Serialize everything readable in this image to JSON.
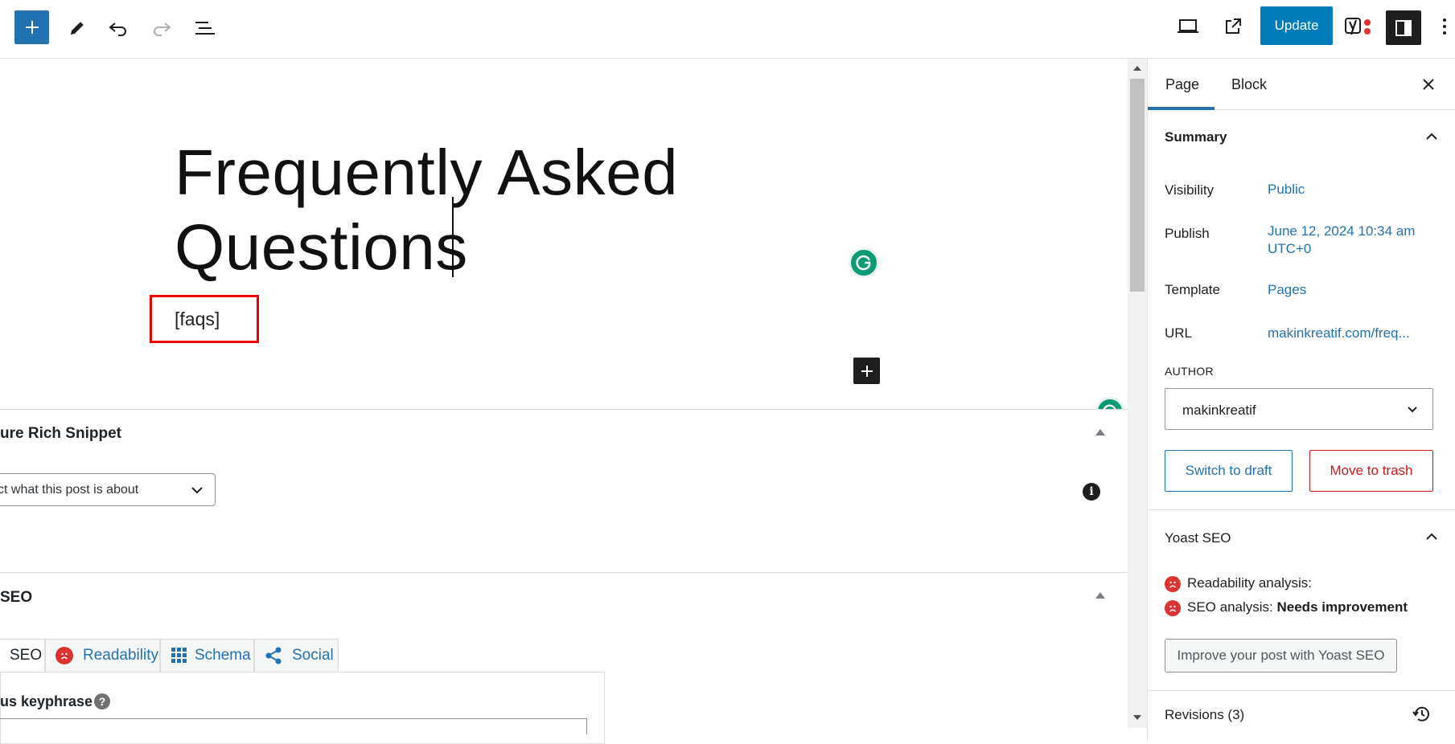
{
  "toolbar": {
    "update_label": "Update"
  },
  "editor": {
    "title_line1": "Frequently Asked",
    "title_line2": "Questions",
    "shortcode": "[faqs]"
  },
  "metaboxes": {
    "rich_snippet_title": "ure Rich Snippet",
    "rich_snippet_select": "ct what this post is about",
    "seo_title": "SEO",
    "tabs": [
      "SEO",
      "Readability",
      "Schema",
      "Social"
    ],
    "keyphrase_label": "us keyphrase"
  },
  "sidebar": {
    "tabs": {
      "page": "Page",
      "block": "Block"
    },
    "summary": {
      "heading": "Summary",
      "rows": [
        {
          "label": "Visibility",
          "value": "Public"
        },
        {
          "label": "Publish",
          "value": "June 12, 2024 10:34 am",
          "value2": "UTC+0"
        },
        {
          "label": "Template",
          "value": "Pages"
        },
        {
          "label": "URL",
          "value": "makinkreatif.com/freq..."
        }
      ],
      "author_label": "AUTHOR",
      "author_value": "makinkreatif",
      "switch_draft": "Switch to draft",
      "move_trash": "Move to trash"
    },
    "yoast": {
      "heading": "Yoast SEO",
      "readability": "Readability analysis:",
      "seo_prefix": "SEO analysis:",
      "seo_status": "Needs improvement",
      "improve_button": "Improve your post with Yoast SEO"
    },
    "revisions": "Revisions (3)"
  },
  "colors": {
    "accent": "#2271b1",
    "update": "#007cba",
    "danger": "#cc1818",
    "yoast_bad": "#dc3232",
    "grammarly": "#0c9a74"
  }
}
